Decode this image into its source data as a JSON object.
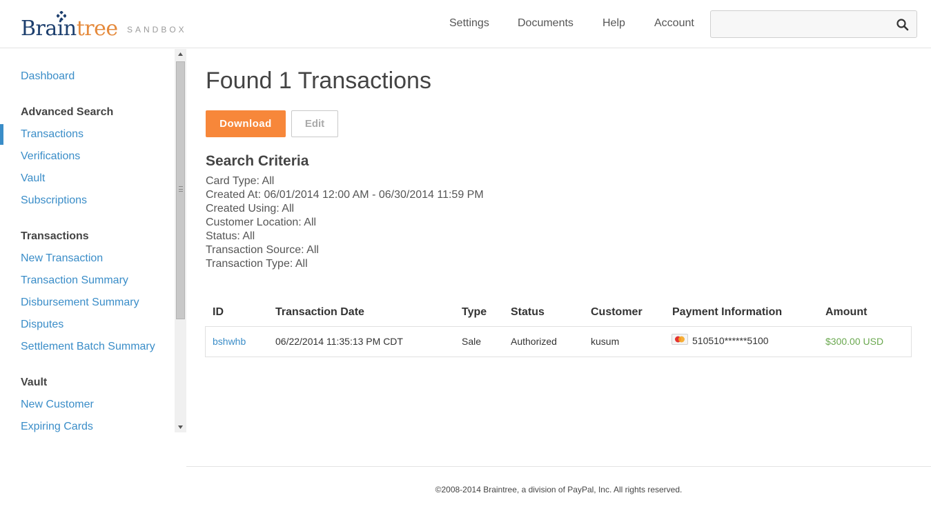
{
  "header": {
    "logo_brain": "Brain",
    "logo_tree": "tree",
    "logo_sandbox": "SANDBOX",
    "nav": [
      "Settings",
      "Documents",
      "Help",
      "Account"
    ],
    "search": {
      "value": "",
      "placeholder": "",
      "icon": "search-icon"
    }
  },
  "sidebar": {
    "dashboard": "Dashboard",
    "sections": [
      {
        "heading": "Advanced Search",
        "items": [
          "Transactions",
          "Verifications",
          "Vault",
          "Subscriptions"
        ]
      },
      {
        "heading": "Transactions",
        "items": [
          "New Transaction",
          "Transaction Summary",
          "Disbursement Summary",
          "Disputes",
          "Settlement Batch Summary"
        ]
      },
      {
        "heading": "Vault",
        "items": [
          "New Customer",
          "Expiring Cards"
        ]
      }
    ],
    "active_item": "Transactions"
  },
  "main": {
    "title": "Found 1 Transactions",
    "download_label": "Download",
    "edit_label": "Edit",
    "criteria_title": "Search Criteria",
    "criteria": [
      "Card Type: All",
      "Created At: 06/01/2014 12:00 AM - 06/30/2014 11:59 PM",
      "Created Using: All",
      "Customer Location: All",
      "Status: All",
      "Transaction Source: All",
      "Transaction Type: All"
    ]
  },
  "table": {
    "columns": [
      "ID",
      "Transaction Date",
      "Type",
      "Status",
      "Customer",
      "Payment Information",
      "Amount"
    ],
    "rows": [
      {
        "id": "bshwhb",
        "date": "06/22/2014 11:35:13 PM CDT",
        "type": "Sale",
        "status": "Authorized",
        "customer": "kusum",
        "card_icon": "mastercard-icon",
        "payment": "510510******5100",
        "amount": "$300.00 USD"
      }
    ]
  },
  "footer": {
    "text": "©2008-2014 Braintree, a division of PayPal, Inc. All rights reserved."
  },
  "colors": {
    "link": "#3a8dc8",
    "accent": "#f7873a",
    "amount": "#6aa84f",
    "logo_navy": "#1d3f6e",
    "logo_orange": "#e58a3c"
  }
}
